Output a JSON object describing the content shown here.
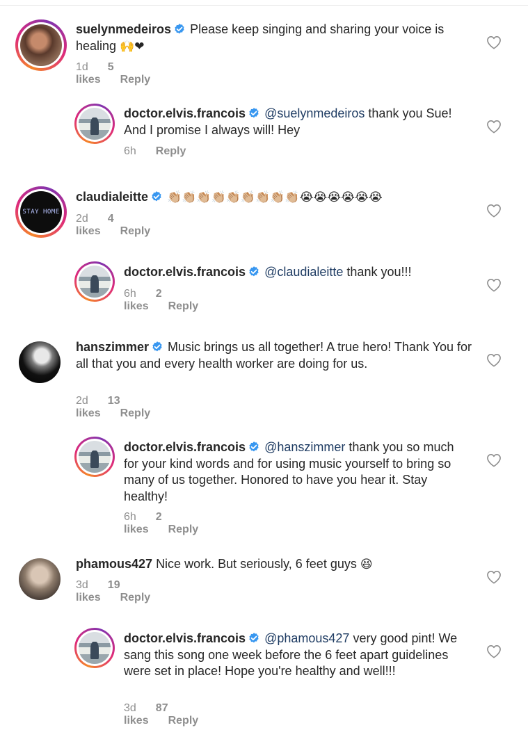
{
  "comments": [
    {
      "username": "suelynmedeiros",
      "text": "Please keep singing and sharing your voice is healing",
      "emoji": "🙌❤",
      "time": "1d",
      "likes": "5 likes",
      "reply": "Reply"
    },
    {
      "username": "doctor.elvis.francois",
      "mention": "@suelynmedeiros",
      "text": "thank you Sue! And I promise I always will! Hey",
      "time": "6h",
      "reply": "Reply"
    },
    {
      "username": "claudialeitte",
      "emoji_claps": "👏🏼👏🏼👏🏼👏🏼👏🏼👏🏼👏🏼👏🏼👏🏼",
      "emoji_cry": "😭😭😭😭😭😭",
      "time": "2d",
      "likes": "4 likes",
      "reply": "Reply",
      "avatar_text": "STAY HOME"
    },
    {
      "username": "doctor.elvis.francois",
      "mention": "@claudialeitte",
      "text": "thank you!!!",
      "time": "6h",
      "likes": "2 likes",
      "reply": "Reply"
    },
    {
      "username": "hanszimmer",
      "text": "Music brings us all together! A true hero! Thank You for all that you and every health worker are doing for us.",
      "time": "2d",
      "likes": "13 likes",
      "reply": "Reply"
    },
    {
      "username": "doctor.elvis.francois",
      "mention": "@hanszimmer",
      "text": "thank you so much for your kind words and for using music yourself to bring so many of us together. Honored to have you hear it. Stay healthy!",
      "time": "6h",
      "likes": "2 likes",
      "reply": "Reply"
    },
    {
      "username": "phamous427",
      "text": "Nice work.  But seriously, 6 feet guys",
      "emoji": "😆",
      "time": "3d",
      "likes": "19 likes",
      "reply": "Reply"
    },
    {
      "username": "doctor.elvis.francois",
      "mention": "@phamous427",
      "text": "very good pint! We sang this song one week before the 6 feet apart guidelines were set in place! Hope you're healthy and well!!!",
      "time": "3d",
      "likes": "87 likes",
      "reply": "Reply"
    }
  ],
  "icons": {
    "verified": "verified-badge-icon",
    "like": "heart-outline-icon"
  },
  "colors": {
    "verified": "#3897f0",
    "mention": "#1f3c63",
    "meta": "#8e8e8e"
  }
}
